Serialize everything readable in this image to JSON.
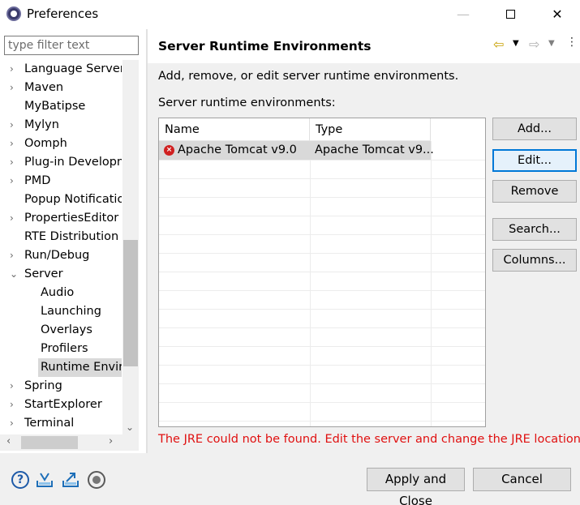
{
  "window": {
    "title": "Preferences",
    "minimize": "—",
    "close": "✕"
  },
  "filter": {
    "placeholder": "type filter text"
  },
  "tree": [
    {
      "label": "Language Servers",
      "level": 0,
      "expander": "›"
    },
    {
      "label": "Maven",
      "level": 0,
      "expander": "›"
    },
    {
      "label": "MyBatipse",
      "level": 0,
      "expander": ""
    },
    {
      "label": "Mylyn",
      "level": 0,
      "expander": "›"
    },
    {
      "label": "Oomph",
      "level": 0,
      "expander": "›"
    },
    {
      "label": "Plug-in Developm",
      "level": 0,
      "expander": "›"
    },
    {
      "label": "PMD",
      "level": 0,
      "expander": "›"
    },
    {
      "label": "Popup Notificatio",
      "level": 0,
      "expander": ""
    },
    {
      "label": "PropertiesEditor",
      "level": 0,
      "expander": "›"
    },
    {
      "label": "RTE Distribution T",
      "level": 0,
      "expander": ""
    },
    {
      "label": "Run/Debug",
      "level": 0,
      "expander": "›"
    },
    {
      "label": "Server",
      "level": 0,
      "expander": "⌄"
    },
    {
      "label": "Audio",
      "level": 1,
      "expander": ""
    },
    {
      "label": "Launching",
      "level": 1,
      "expander": ""
    },
    {
      "label": "Overlays",
      "level": 1,
      "expander": ""
    },
    {
      "label": "Profilers",
      "level": 1,
      "expander": ""
    },
    {
      "label": "Runtime Enviro",
      "level": 1,
      "expander": "",
      "selected": true
    },
    {
      "label": "Spring",
      "level": 0,
      "expander": "›"
    },
    {
      "label": "StartExplorer",
      "level": 0,
      "expander": "›"
    },
    {
      "label": "Terminal",
      "level": 0,
      "expander": "›"
    }
  ],
  "page": {
    "title": "Server Runtime Environments",
    "description": "Add, remove, or edit server runtime environments.",
    "list_label": "Server runtime environments:",
    "columns": [
      "Name",
      "Type"
    ],
    "rows": [
      {
        "name": "Apache Tomcat v9.0",
        "type": "Apache Tomcat v9...",
        "status": "error"
      }
    ],
    "buttons": {
      "add": "Add...",
      "edit": "Edit...",
      "remove": "Remove",
      "search": "Search...",
      "columns": "Columns..."
    },
    "error": "The JRE could not be found. Edit the server and change the JRE location."
  },
  "footer": {
    "apply_close": "Apply and Close",
    "cancel": "Cancel",
    "help": "?"
  }
}
